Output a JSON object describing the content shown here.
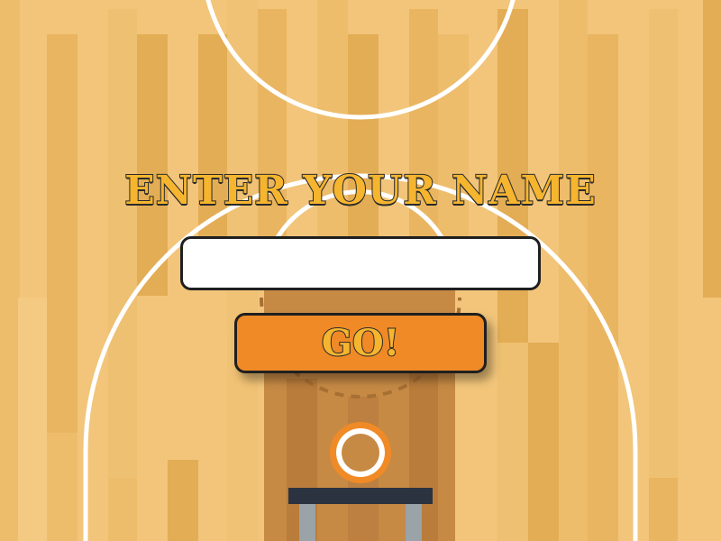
{
  "screen": {
    "title": "ENTER YOUR NAME",
    "name_input": {
      "value": "",
      "placeholder": ""
    },
    "go_button_label": "GO!"
  },
  "colors": {
    "court_wood": "#f2c57a",
    "court_wood_dark": "#e3ad55",
    "paint_area": "#c68a45",
    "court_lines": "#ffffff",
    "title_fill": "#f6b52f",
    "outline": "#1f1f1f",
    "go_button": "#f08a26",
    "hoop_ring": "#f08a26",
    "backboard": "#2b3340",
    "hoop_posts": "#9aa3a8"
  }
}
